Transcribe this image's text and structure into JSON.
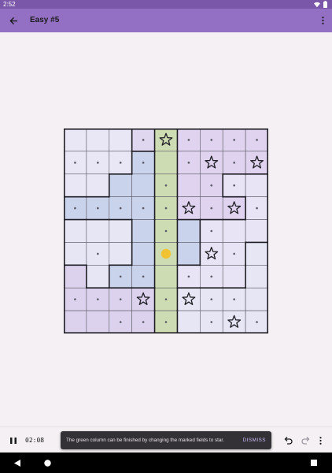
{
  "status_bar": {
    "time": "2:52",
    "icons": [
      "wifi-icon",
      "battery-icon"
    ]
  },
  "app_bar": {
    "title": "Easy #5",
    "back_icon": "arrow-back-icon",
    "menu_icon": "more-vert-icon"
  },
  "board": {
    "size": 9,
    "colors": {
      "A": "#e9e6f5",
      "B": "#dfd6f0",
      "C": "#c9d3ec",
      "D": "#cddcb2",
      "E": "#dfd3ef",
      "F": "#e8e4f5",
      "G": "#c9d3ec",
      "H": "#e6e6f5",
      "I": "#dcd2ee",
      "grid": "#5d5a66",
      "region_border": "#1f1d24",
      "dot": "#5b5a66",
      "star": "#1f1d24",
      "hint": "#f1c232"
    },
    "regions": [
      "AAABDEEEE",
      "AAACDEEEE",
      "AACCDEEFF",
      "CCCCDEEEF",
      "HHHCDGFFF",
      "HHHCDGFFH",
      "IHCCDFFFH",
      "IIIIDHHHH",
      "IIIIDHHHH"
    ],
    "cells": [
      "---.*....",
      "....-.*.*",
      "----.-..-",
      ".....*.*.",
      "----.-.--",
      "-.--o-*.-",
      "--..-..--",
      "...*.*..-",
      "--...-.*."
    ],
    "legend": {
      "*": "star",
      ".": "marked",
      "o": "hint",
      "-": "empty"
    }
  },
  "bottom_bar": {
    "pause_icon": "pause-icon",
    "timer": "02:08",
    "undo_icon": "undo-icon",
    "redo_icon": "redo-icon",
    "more_icon": "more-vert-icon"
  },
  "snackbar": {
    "message": "The green column can be finished by changing the marked fields to star.",
    "action": "DISMISS"
  },
  "nav_bar": {
    "buttons": [
      "back-triangle-icon",
      "home-circle-icon",
      "recents-square-icon"
    ]
  }
}
